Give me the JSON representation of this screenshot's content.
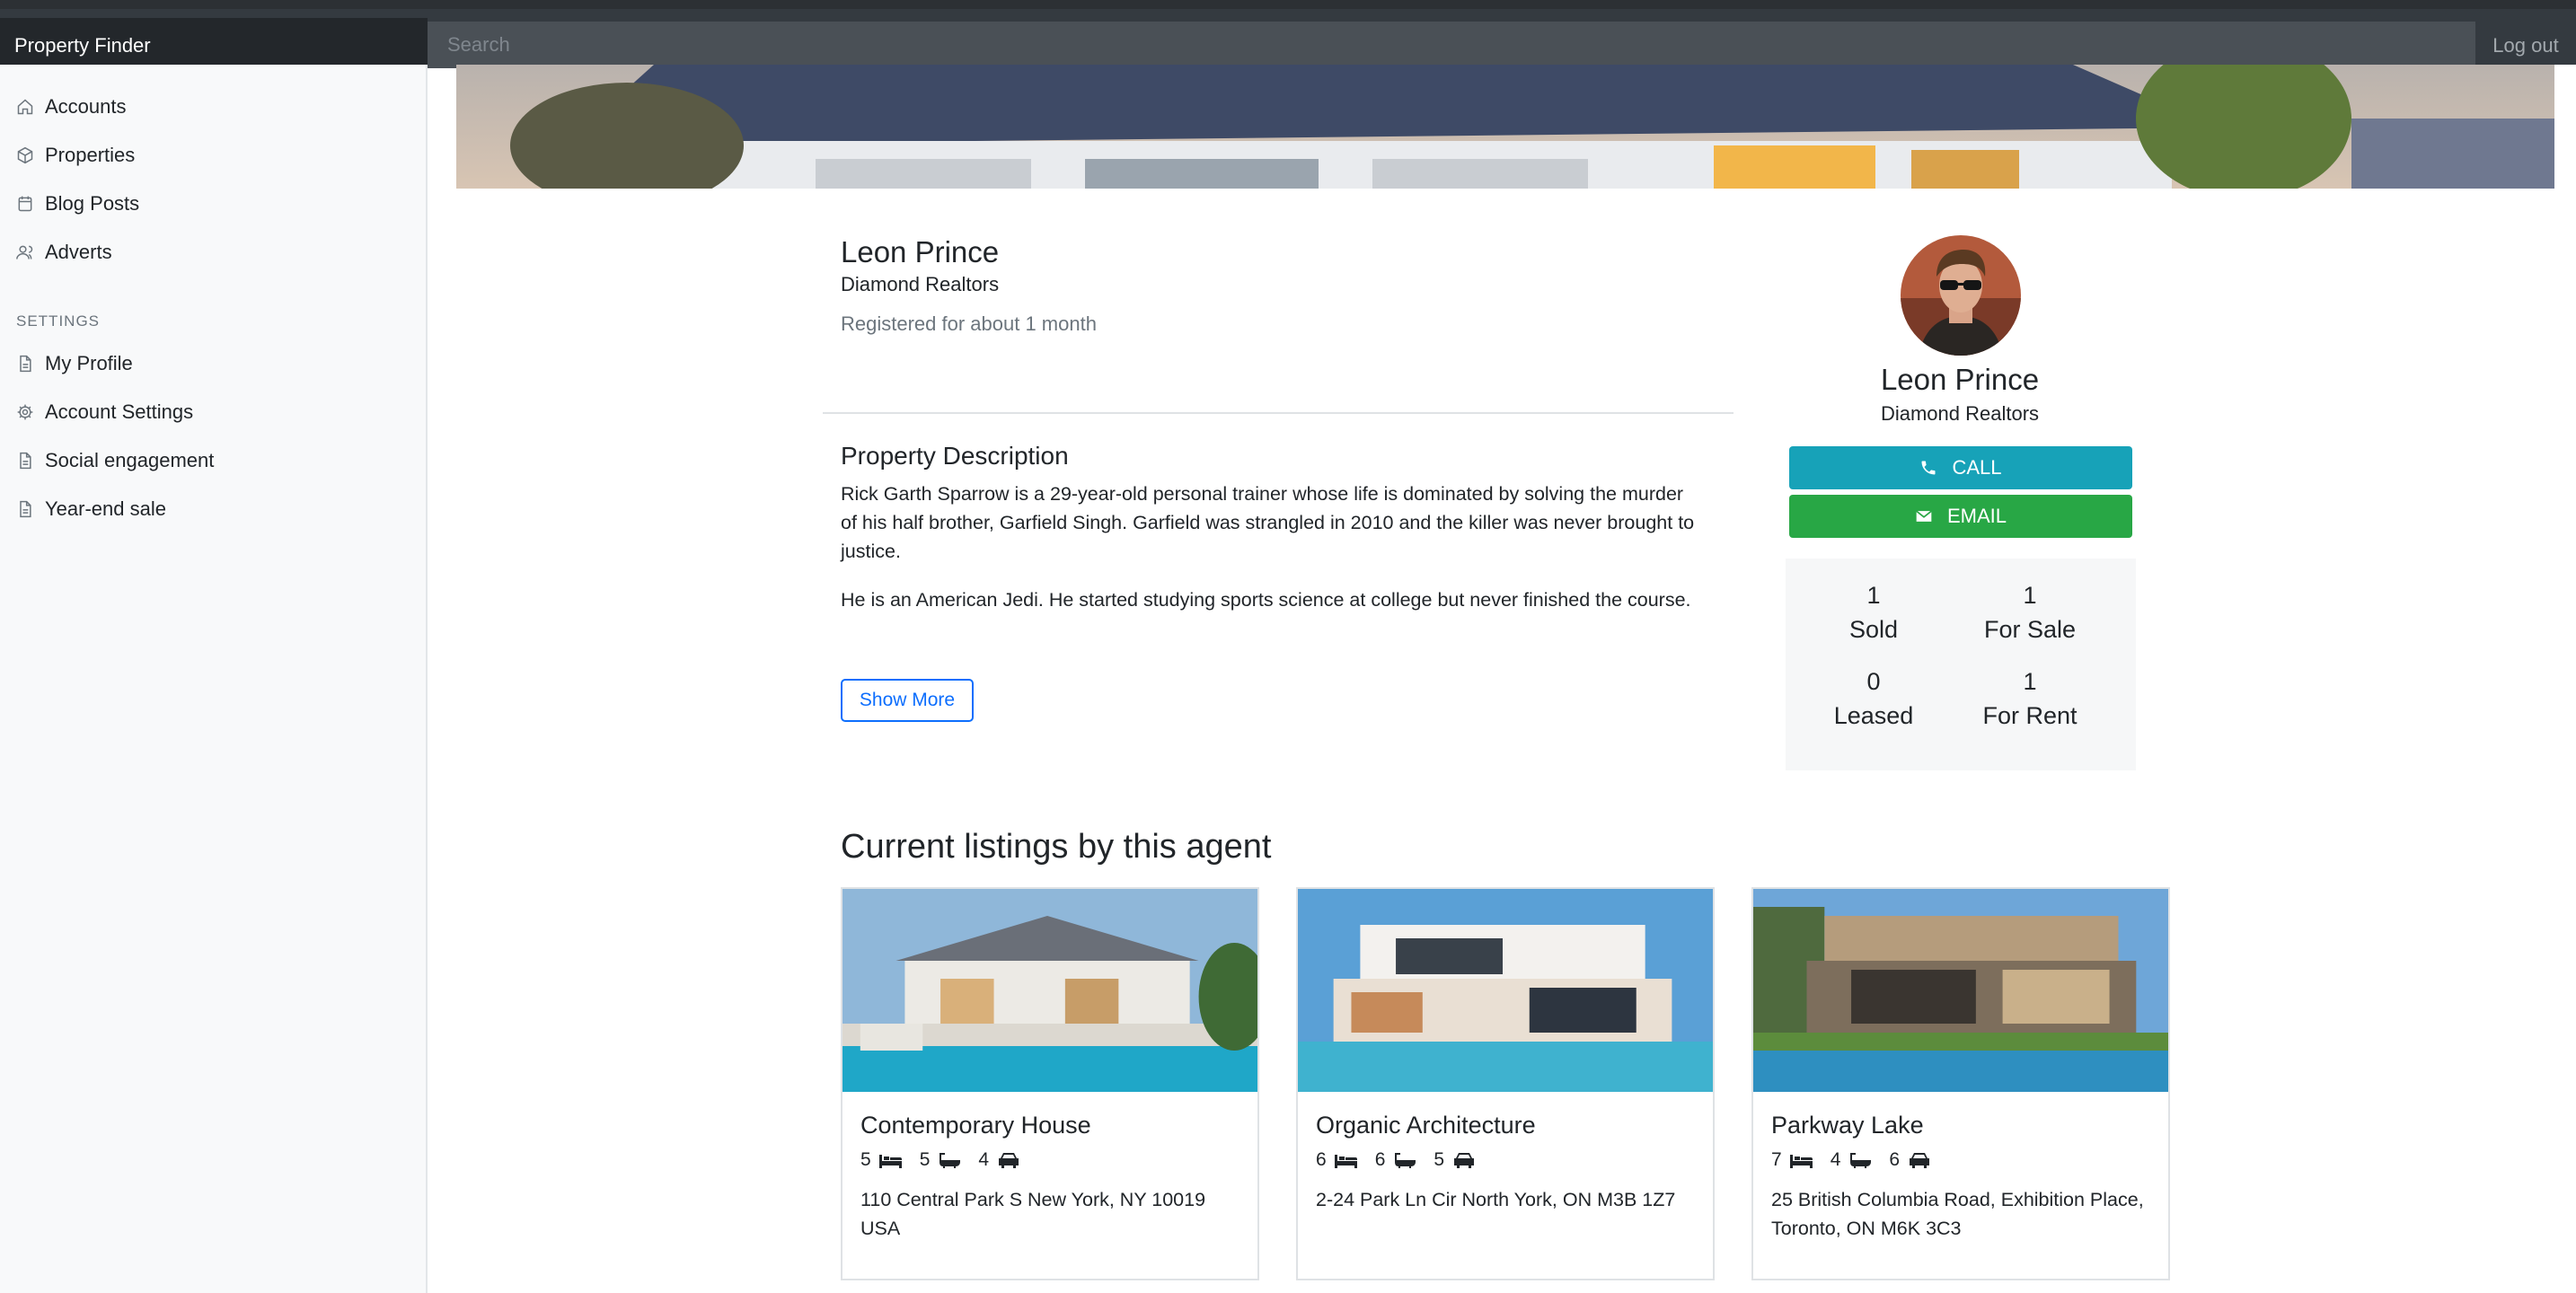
{
  "app": {
    "brand": "Property Finder",
    "logout": "Log out"
  },
  "search": {
    "placeholder": "Search"
  },
  "sidebar": {
    "items": [
      {
        "label": "Accounts",
        "icon": "home-icon"
      },
      {
        "label": "Properties",
        "icon": "box-icon"
      },
      {
        "label": "Blog Posts",
        "icon": "calendar-icon"
      },
      {
        "label": "Adverts",
        "icon": "users-icon"
      }
    ],
    "settings_heading": "SETTINGS",
    "settings_items": [
      {
        "label": "My Profile",
        "icon": "file-icon"
      },
      {
        "label": "Account Settings",
        "icon": "gear-icon"
      },
      {
        "label": "Social engagement",
        "icon": "file-icon"
      },
      {
        "label": "Year-end sale",
        "icon": "file-icon"
      }
    ]
  },
  "agent": {
    "name": "Leon Prince",
    "company": "Diamond Realtors",
    "registered": "Registered for about 1 month"
  },
  "description": {
    "title": "Property Description",
    "paragraphs": [
      "Rick Garth Sparrow is a 29-year-old personal trainer whose life is dominated by solving the murder of his half brother, Garfield Singh. Garfield was strangled in 2010 and the killer was never brought to justice.",
      "He is an American Jedi. He started studying sports science at college but never finished the course."
    ],
    "show_more": "Show More"
  },
  "card": {
    "call": "CALL",
    "email": "EMAIL",
    "stats": [
      {
        "value": "1",
        "label": "Sold"
      },
      {
        "value": "1",
        "label": "For Sale"
      },
      {
        "value": "0",
        "label": "Leased"
      },
      {
        "value": "1",
        "label": "For Rent"
      }
    ]
  },
  "listings": {
    "title": "Current listings by this agent",
    "items": [
      {
        "name": "Contemporary House",
        "beds": "5",
        "baths": "5",
        "cars": "4",
        "address": "110 Central Park S New York, NY 10019 USA"
      },
      {
        "name": "Organic Architecture",
        "beds": "6",
        "baths": "6",
        "cars": "5",
        "address": "2-24 Park Ln Cir North York, ON M3B 1Z7"
      },
      {
        "name": "Parkway Lake",
        "beds": "7",
        "baths": "4",
        "cars": "6",
        "address": "25 British Columbia Road, Exhibition Place, Toronto, ON M6K 3C3"
      }
    ]
  },
  "colors": {
    "call": "#17a2b8",
    "email": "#28a745",
    "primary": "#0d6efd",
    "topbar": "#343a40"
  }
}
